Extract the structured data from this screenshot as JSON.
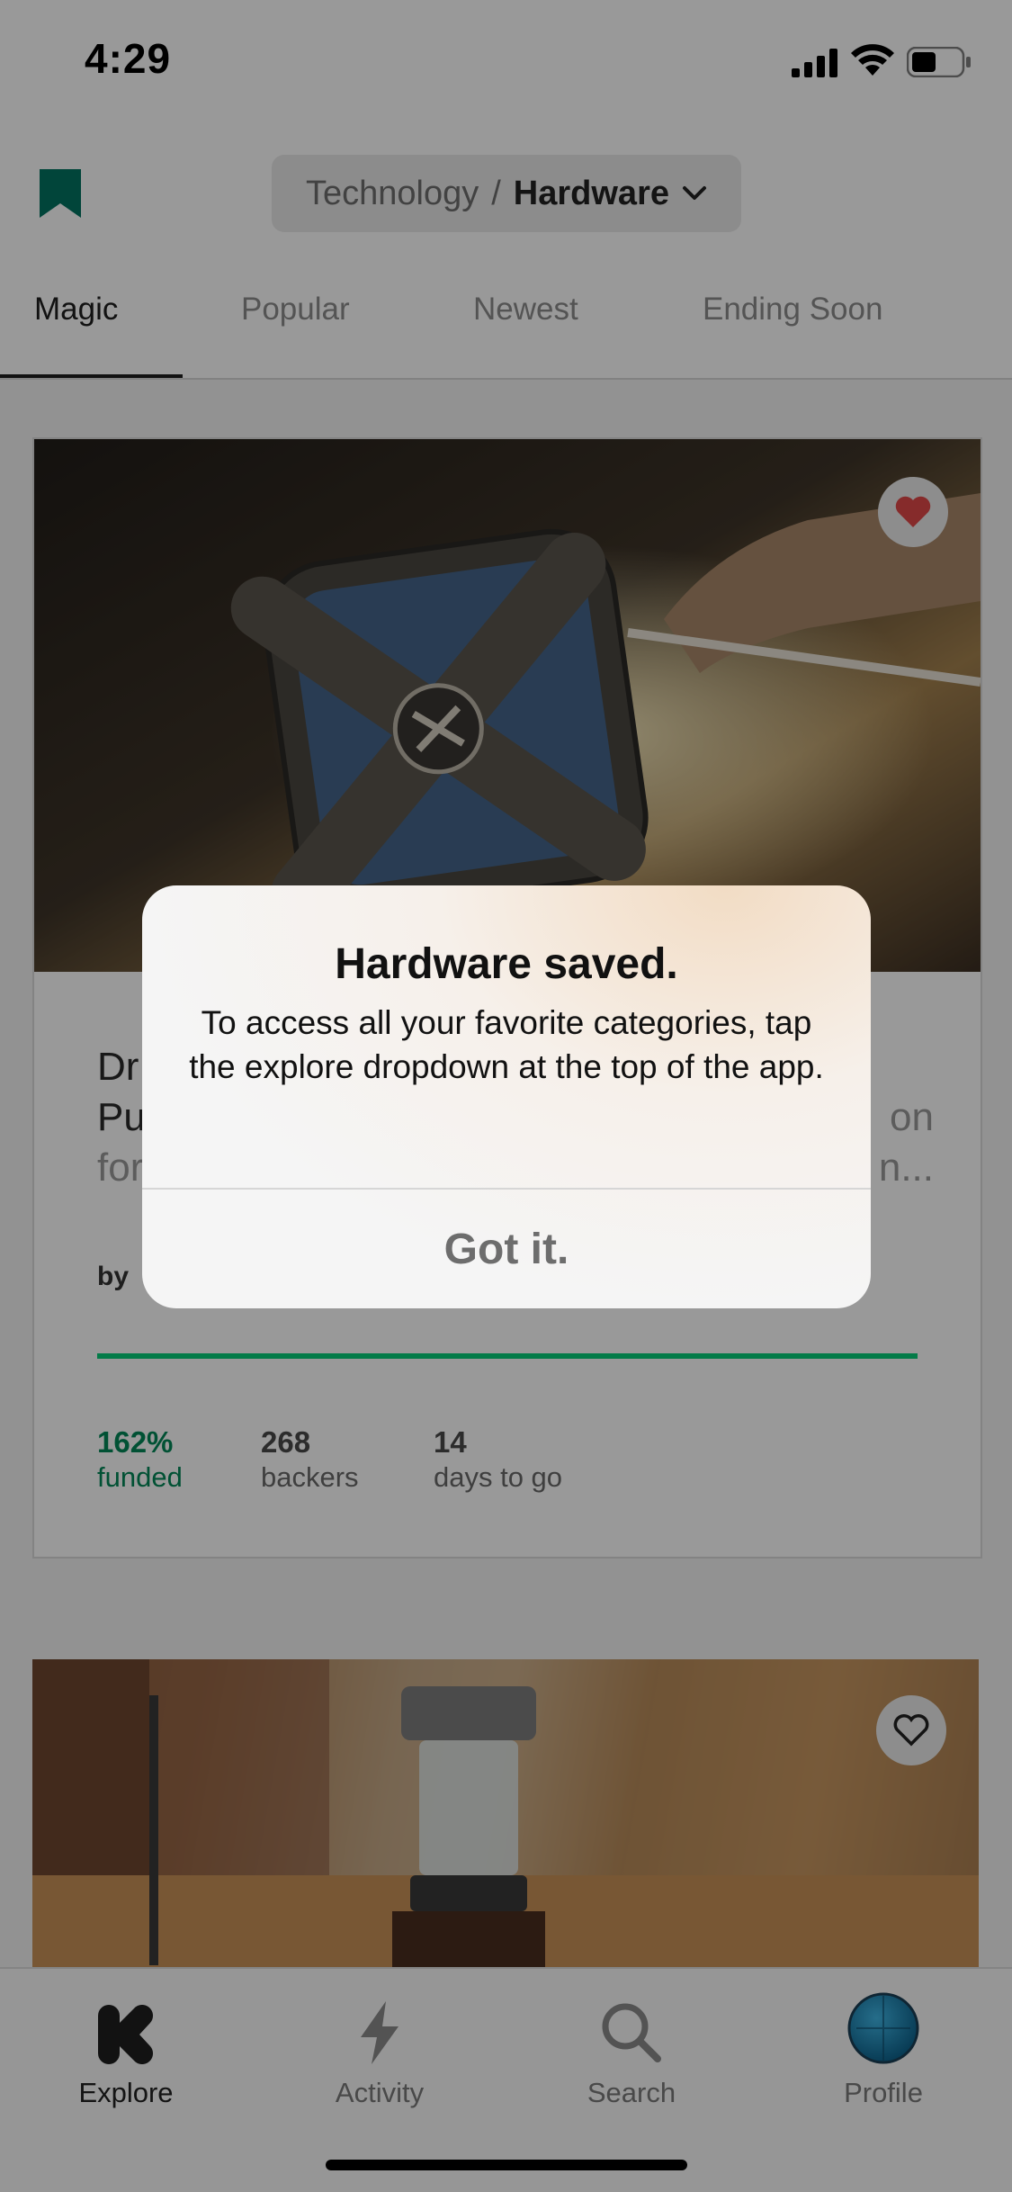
{
  "status_bar": {
    "time": "4:29"
  },
  "header": {
    "breadcrumb_parent": "Technology",
    "breadcrumb_separator": "/",
    "breadcrumb_current": "Hardware"
  },
  "tabs": [
    {
      "label": "Magic",
      "active": true
    },
    {
      "label": "Popular",
      "active": false
    },
    {
      "label": "Newest",
      "active": false
    },
    {
      "label": "Ending Soon",
      "active": false
    }
  ],
  "project_card": {
    "title_line1": "Dr",
    "title_line2": "Pu",
    "title_line2_end": "on",
    "title_line3": "for",
    "title_line3_end": "n...",
    "byline": "by",
    "funded_percent": 1.62,
    "stats": [
      {
        "value": "162%",
        "label": "funded"
      },
      {
        "value": "268",
        "label": "backers"
      },
      {
        "value": "14",
        "label": "days to go"
      }
    ]
  },
  "alert": {
    "title": "Hardware saved.",
    "message": "To access all your favorite categories, tap the explore dropdown at the top of the app.",
    "button": "Got it."
  },
  "tab_bar": [
    {
      "label": "Explore",
      "icon": "kickstarter-k-icon",
      "active": true
    },
    {
      "label": "Activity",
      "icon": "lightning-icon",
      "active": false
    },
    {
      "label": "Search",
      "icon": "search-icon",
      "active": false
    },
    {
      "label": "Profile",
      "icon": "avatar-icon",
      "active": false
    }
  ],
  "colors": {
    "brand_green": "#05ce78",
    "funded_text": "#028858",
    "bookmark": "#037362",
    "heart_red": "#e04848"
  }
}
